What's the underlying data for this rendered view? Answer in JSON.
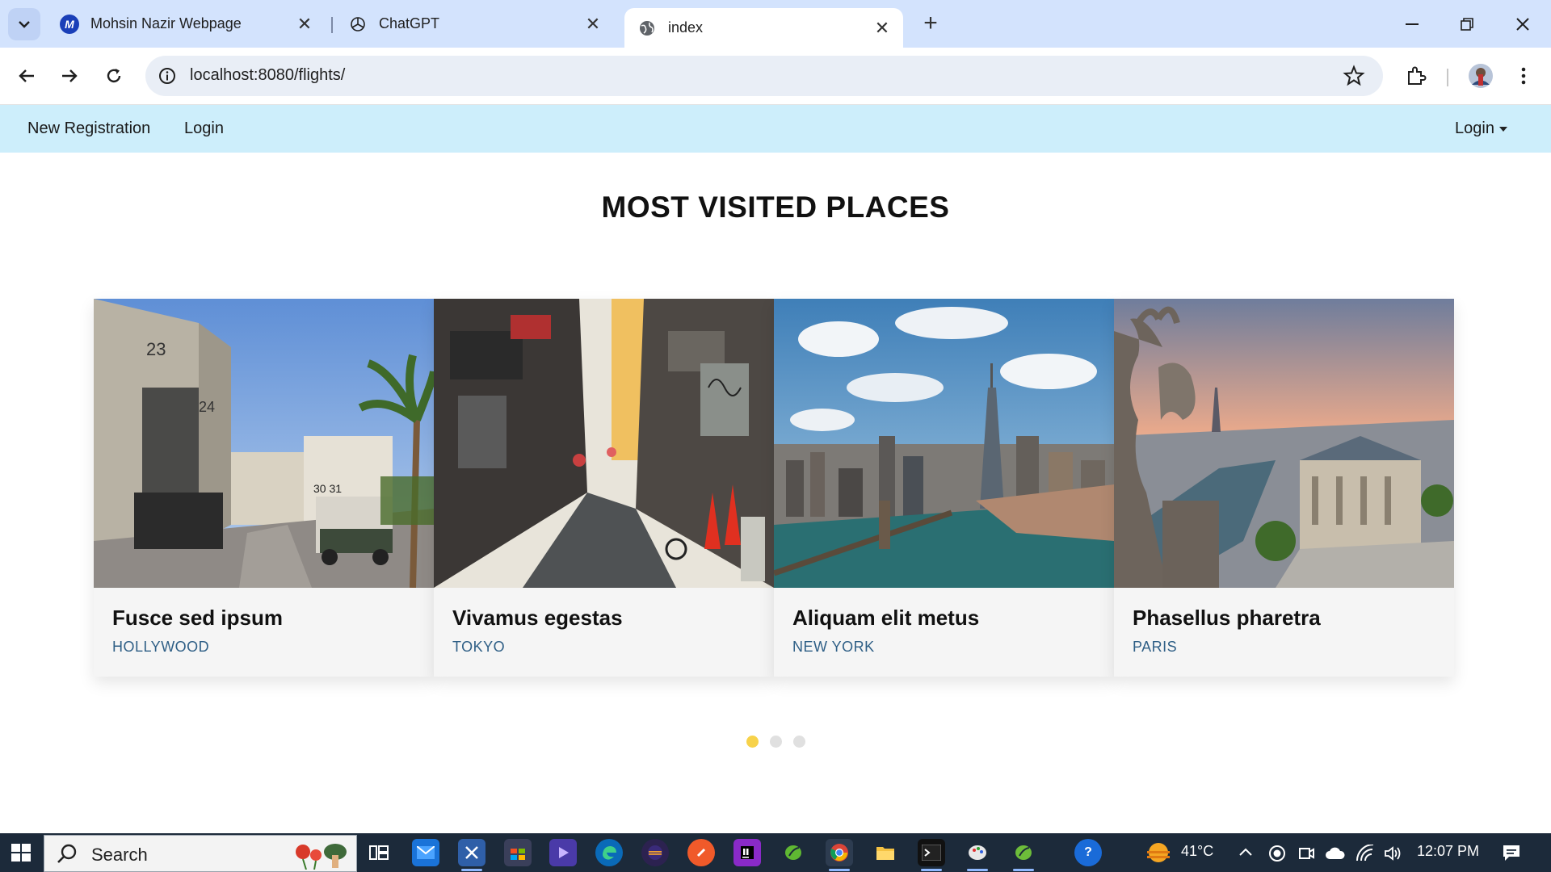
{
  "browser": {
    "tabs": [
      {
        "title": "Mohsin Nazir Webpage",
        "favicon": "M",
        "active": false
      },
      {
        "title": "ChatGPT",
        "active": false
      },
      {
        "title": "index",
        "active": true
      }
    ],
    "url": "localhost:8080/flights/"
  },
  "navbar": {
    "links": [
      "New Registration",
      "Login"
    ],
    "dropdown_label": "Login",
    "background": "#cdeefb"
  },
  "page": {
    "heading": "MOST VISITED PLACES",
    "cards": [
      {
        "title": "Fusce sed ipsum",
        "location": "HOLLYWOOD"
      },
      {
        "title": "Vivamus egestas",
        "location": "TOKYO"
      },
      {
        "title": "Aliquam elit metus",
        "location": "NEW YORK"
      },
      {
        "title": "Phasellus pharetra",
        "location": "PARIS"
      }
    ],
    "carousel_dots": 3,
    "carousel_active_dot": 1,
    "accent_color": "#f7d24a",
    "location_color": "#2f5f86"
  },
  "taskbar": {
    "search_label": "Search",
    "weather": "41°C",
    "time": "12:07 PM"
  }
}
